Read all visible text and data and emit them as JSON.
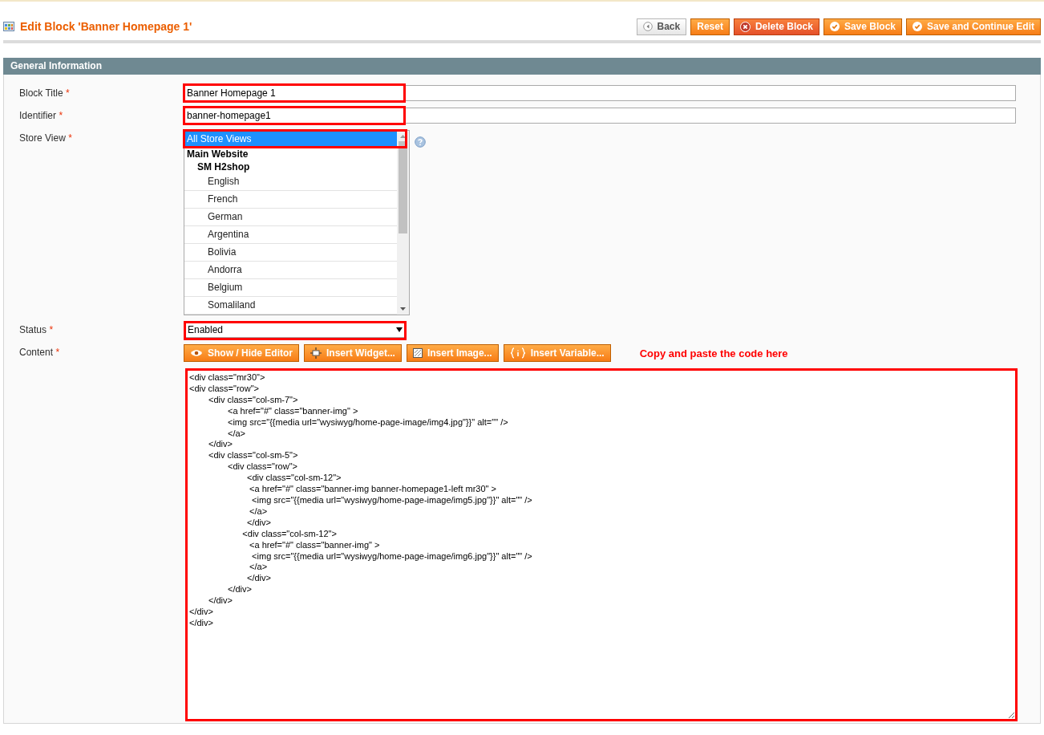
{
  "header": {
    "title": "Edit Block 'Banner Homepage 1'",
    "buttons": [
      {
        "label": "Back",
        "kind": "back"
      },
      {
        "label": "Reset",
        "kind": "plain"
      },
      {
        "label": "Delete Block",
        "kind": "delete"
      },
      {
        "label": "Save Block",
        "kind": "save"
      },
      {
        "label": "Save and Continue Edit",
        "kind": "save"
      }
    ]
  },
  "section": {
    "title": "General Information"
  },
  "fields": [
    {
      "label": "Block Title",
      "required_mark": "*",
      "kind": "text",
      "value": "Banner Homepage 1",
      "highlighted": true
    },
    {
      "label": "Identifier",
      "required_mark": "*",
      "kind": "text",
      "value": "banner-homepage1",
      "highlighted": true
    },
    {
      "label": "Store View",
      "required_mark": "*",
      "kind": "multiselect",
      "highlighted": true,
      "options": [
        {
          "label": "All Store Views",
          "selected": true
        },
        {
          "label": "Main Website",
          "selected": false,
          "children": [
            {
              "label": "SM H2shop",
              "selected": false,
              "children": [
                {
                  "label": "English",
                  "selected": false
                },
                {
                  "label": "French",
                  "selected": false
                },
                {
                  "label": "German",
                  "selected": false
                },
                {
                  "label": "Argentina",
                  "selected": false
                },
                {
                  "label": "Bolivia",
                  "selected": false
                },
                {
                  "label": "Andorra",
                  "selected": false
                },
                {
                  "label": "Belgium",
                  "selected": false
                },
                {
                  "label": "Somaliland",
                  "selected": false
                }
              ]
            }
          ]
        }
      ]
    },
    {
      "label": "Status",
      "required_mark": "*",
      "kind": "select",
      "value": "Enabled",
      "highlighted": true
    },
    {
      "label": "Content",
      "required_mark": "*",
      "kind": "editor",
      "highlighted": true,
      "buttons": [
        {
          "label": "Show / Hide Editor",
          "kind": "eye"
        },
        {
          "label": "Insert Widget...",
          "kind": "widget"
        },
        {
          "label": "Insert Image...",
          "kind": "image"
        },
        {
          "label": "Insert Variable...",
          "kind": "variable"
        }
      ],
      "note": "Copy and paste the code here",
      "value": "<div class=\"mr30\">\n<div class=\"row\">\n\t<div class=\"col-sm-7\">\n\t\t<a href=\"#\" class=\"banner-img\" >\n\t\t<img src=\"{{media url=\"wysiwyg/home-page-image/img4.jpg\"}}\" alt=\"\" />\n\t\t</a>\n\t</div>\n\t<div class=\"col-sm-5\">\n\t\t<div class=\"row\">\n\t\t\t<div class=\"col-sm-12\">\n\t\t\t <a href=\"#\" class=\"banner-img banner-homepage1-left mr30\" >\n\t\t\t  <img src=\"{{media url=\"wysiwyg/home-page-image/img5.jpg\"}}\" alt=\"\" />\n\t\t\t </a>\n\t\t\t</div>\n\t\t      <div class=\"col-sm-12\">\n\t\t\t <a href=\"#\" class=\"banner-img\" >\n\t\t\t  <img src=\"{{media url=\"wysiwyg/home-page-image/img6.jpg\"}}\" alt=\"\" />\n\t\t\t </a>\n\t\t\t</div>\n\t\t</div>\n\t</div>\n</div>\n</div>"
    }
  ]
}
